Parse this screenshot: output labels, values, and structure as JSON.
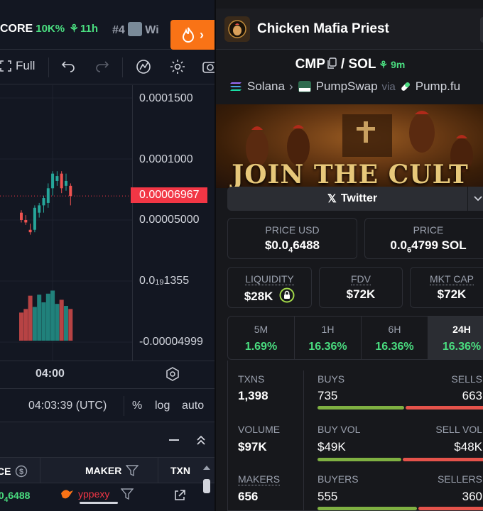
{
  "left": {
    "ticker": {
      "symbol": "CORE",
      "value": "10K%",
      "age": "11h"
    },
    "rank": {
      "label": "#4",
      "name": "Wi"
    },
    "toolbar": {
      "full_label": "Full"
    },
    "price_axis": {
      "labels": [
        "0.0001500",
        "0.0001000",
        "0.00005000",
        "-0.00004999"
      ],
      "current": "0.00006967",
      "volume_label": {
        "prefix": "0.0",
        "sub": "19",
        "suffix": "1355"
      }
    },
    "time_label": "04:00",
    "clock": "04:03:39 (UTC)",
    "scale_options": [
      "%",
      "log",
      "auto"
    ],
    "trades": {
      "col_price": "CE",
      "col_maker": "MAKER",
      "col_txn": "TXN",
      "row": {
        "price_sub": "4",
        "price_tail": "6488",
        "maker": "yppexy"
      }
    },
    "colors": {
      "up": "#26a69a",
      "down": "#ef5350",
      "current": "#f23645"
    }
  },
  "candles": [
    {
      "o": 5.6e-05,
      "h": 5.8e-05,
      "l": 4.8e-05,
      "c": 5e-05,
      "v": 0.55
    },
    {
      "o": 5e-05,
      "h": 5.4e-05,
      "l": 4.6e-05,
      "c": 4.8e-05,
      "v": 0.62
    },
    {
      "o": 4.2e-05,
      "h": 4.7e-05,
      "l": 3.8e-05,
      "c": 4e-05,
      "v": 0.88
    },
    {
      "o": 4.2e-05,
      "h": 6.2e-05,
      "l": 4e-05,
      "c": 6e-05,
      "v": 0.66
    },
    {
      "o": 5.6e-05,
      "h": 6.4e-05,
      "l": 5.2e-05,
      "c": 6.2e-05,
      "v": 0.9
    },
    {
      "o": 6.2e-05,
      "h": 7e-05,
      "l": 5.6e-05,
      "c": 6.8e-05,
      "v": 0.75
    },
    {
      "o": 6.4e-05,
      "h": 8e-05,
      "l": 6e-05,
      "c": 7.6e-05,
      "v": 0.92
    },
    {
      "o": 7.6e-05,
      "h": 9e-05,
      "l": 7e-05,
      "c": 8.8e-05,
      "v": 0.98
    },
    {
      "o": 8.2e-05,
      "h": 9e-05,
      "l": 7.8e-05,
      "c": 8.6e-05,
      "v": 0.72
    },
    {
      "o": 8.8e-05,
      "h": 9e-05,
      "l": 7.2e-05,
      "c": 7.6e-05,
      "v": 0.8
    },
    {
      "o": 7.8e-05,
      "h": 8.8e-05,
      "l": 7.4e-05,
      "c": 8.2e-05,
      "v": 0.68
    },
    {
      "o": 7.8e-05,
      "h": 8e-05,
      "l": 6.2e-05,
      "c": 6.97e-05,
      "v": 0.62
    }
  ],
  "right": {
    "token_name": "Chicken Mafia Priest",
    "pair": {
      "base": "CMP",
      "sep": "/",
      "quote": "SOL",
      "age": "9m"
    },
    "chain": "Solana",
    "dex": "PumpSwap",
    "via_label": "via",
    "via_source": "Pump.fu",
    "banner_text": "JOIN THE CULT",
    "social_label": "Twitter",
    "price_usd": {
      "label": "PRICE USD",
      "prefix": "$0.0",
      "sub": "4",
      "tail": "6488"
    },
    "price_sol": {
      "label": "PRICE",
      "prefix": "0.0",
      "sub": "6",
      "tail": "4799 SOL"
    },
    "liquidity": {
      "label": "LIQUIDITY",
      "value": "$28K"
    },
    "fdv": {
      "label": "FDV",
      "value": "$72K"
    },
    "mkt_cap": {
      "label": "MKT CAP",
      "value": "$72K"
    },
    "timeframes": [
      {
        "name": "5M",
        "pct": "1.69%"
      },
      {
        "name": "1H",
        "pct": "16.36%"
      },
      {
        "name": "6H",
        "pct": "16.36%"
      },
      {
        "name": "24H",
        "pct": "16.36%"
      }
    ],
    "stats": {
      "txns": {
        "label": "TXNS",
        "value": "1,398"
      },
      "buys": {
        "label": "BUYS",
        "value": "735"
      },
      "sells": {
        "label": "SELLS",
        "value": "663"
      },
      "volume": {
        "label": "VOLUME",
        "value": "$97K"
      },
      "buy_vol": {
        "label": "BUY VOL",
        "value": "$49K"
      },
      "sell_vol": {
        "label": "SELL VOL",
        "value": "$48K"
      },
      "makers": {
        "label": "MAKERS",
        "value": "656"
      },
      "buyers": {
        "label": "BUYERS",
        "value": "555"
      },
      "sellers": {
        "label": "SELLERS",
        "value": "360"
      }
    },
    "colors": {
      "green": "#4ade80",
      "bar_green": "#7fb042",
      "bar_red": "#e5534b"
    }
  }
}
